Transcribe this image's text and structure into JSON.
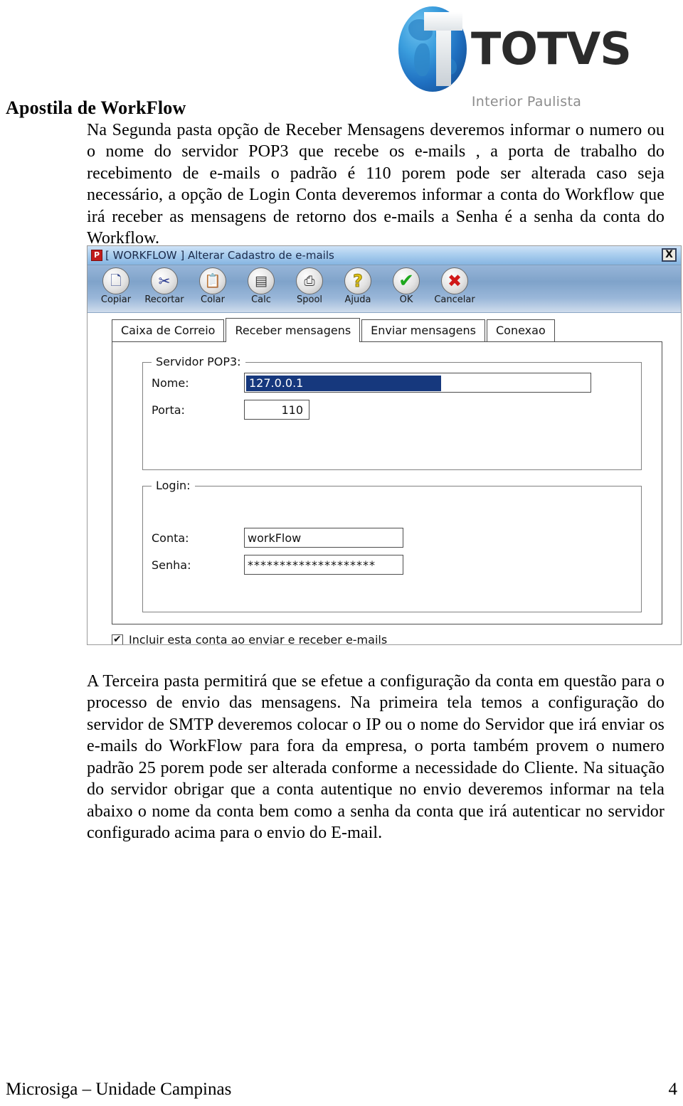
{
  "header": {
    "logo_word": "TOTVS",
    "logo_subtitle": "Interior Paulista",
    "doc_title": "Apostila de WorkFlow"
  },
  "body": {
    "paragraph_1": "Na Segunda pasta opção de Receber Mensagens deveremos informar o numero ou o nome do servidor POP3 que recebe os e-mails , a porta de trabalho do recebimento de e-mails o padrão é 110 porem pode ser alterada caso seja necessário, a opção de Login Conta deveremos informar a conta do Workflow que irá receber as mensagens de retorno dos e-mails a Senha é a senha da conta do Workflow.",
    "paragraph_2": "A Terceira  pasta permitirá que se efetue a configuração da conta em questão para o processo de envio das mensagens. Na primeira tela temos a configuração do servidor de SMTP deveremos colocar o IP ou o nome do Servidor que irá enviar os e-mails do WorkFlow para fora da empresa, o porta também provem o numero padrão 25 porem pode ser alterada conforme a necessidade do Cliente. Na situação do servidor obrigar que  a conta autentique no envio deveremos informar na tela abaixo o nome da conta bem como a senha da conta que irá autenticar no servidor configurado acima para o envio do E-mail."
  },
  "footer": {
    "left": "Microsiga – Unidade Campinas",
    "page": "4"
  },
  "dialog": {
    "title": "[ WORKFLOW ] Alterar Cadastro de e-mails",
    "app_icon_letter": "P",
    "close_label": "X",
    "toolbar": [
      {
        "label": "Copiar",
        "icon": "copy-icon",
        "glyph": "⎘"
      },
      {
        "label": "Recortar",
        "icon": "scissors-icon",
        "glyph": "✂"
      },
      {
        "label": "Colar",
        "icon": "paste-icon",
        "glyph": "ὌB"
      },
      {
        "label": "Calc",
        "icon": "calc-icon",
        "glyph": "▤"
      },
      {
        "label": "Spool",
        "icon": "printer-icon",
        "glyph": "⎙"
      },
      {
        "label": "Ajuda",
        "icon": "help-icon",
        "glyph": "?"
      },
      {
        "label": "OK",
        "icon": "check-icon",
        "glyph": "✔"
      },
      {
        "label": "Cancelar",
        "icon": "cross-icon",
        "glyph": "✖"
      }
    ],
    "tabs": [
      {
        "label": "Caixa de Correio",
        "active": false
      },
      {
        "label": "Receber mensagens",
        "active": true
      },
      {
        "label": "Enviar mensagens",
        "active": false
      },
      {
        "label": "Conexao",
        "active": false
      }
    ],
    "groups": {
      "pop3": {
        "title": "Servidor POP3:",
        "nome_label": "Nome:",
        "nome_value": "127.0.0.1",
        "porta_label": "Porta:",
        "porta_value": "110"
      },
      "login": {
        "title": "Login:",
        "conta_label": "Conta:",
        "conta_value": "workFlow",
        "senha_label": "Senha:",
        "senha_value": "********************"
      }
    },
    "checkbox": {
      "label": "Incluir esta conta ao enviar e receber e-mails",
      "checked": true
    }
  },
  "colors": {
    "titlebar_blue": "#a9cdee",
    "toolbar_blue": "#7fa3ca",
    "selection_blue": "#16387d",
    "logo_globe_blue": "#1f6fc0",
    "logo_text": "#2b2b2b",
    "logo_sub_gray": "#8c8c8c"
  }
}
